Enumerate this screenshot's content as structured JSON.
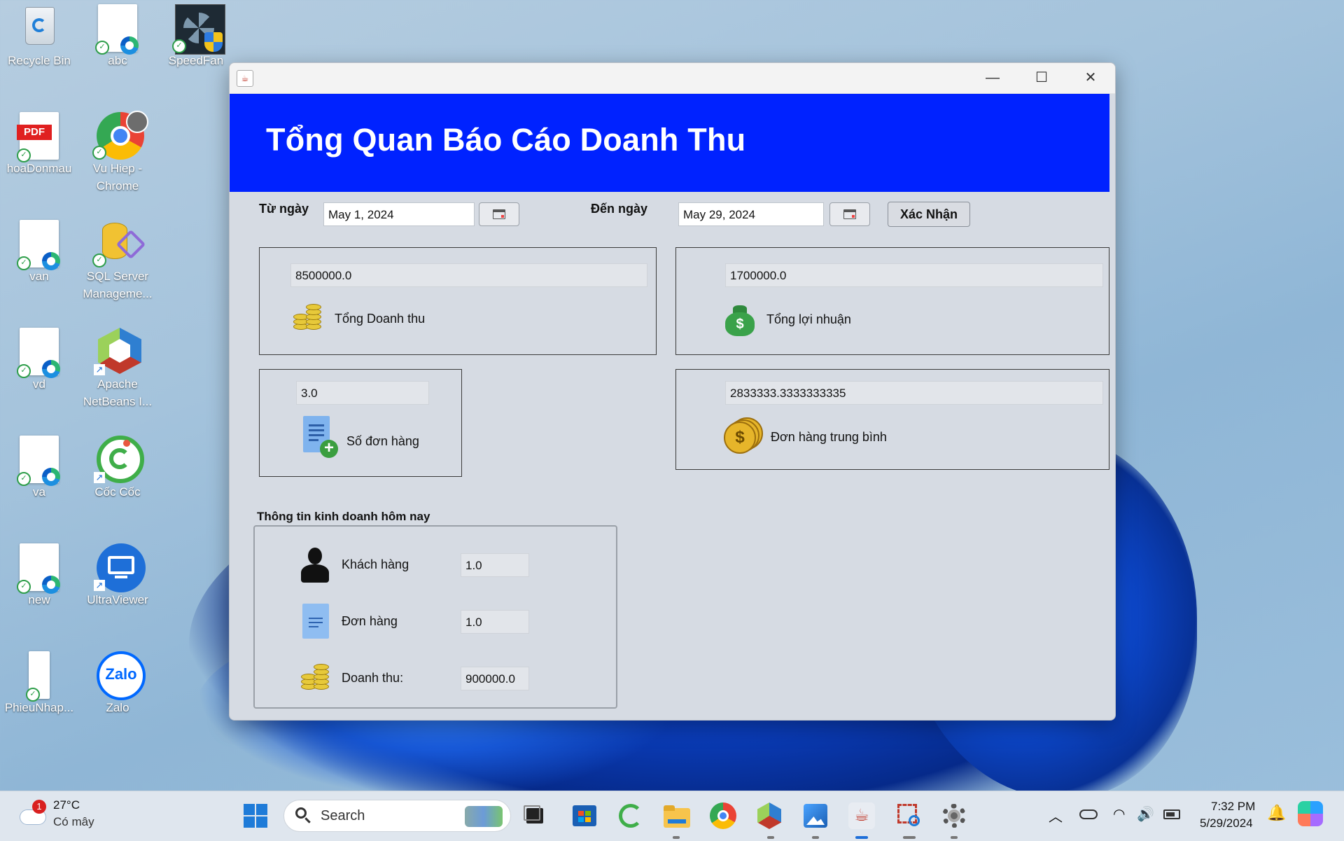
{
  "desktop": {
    "icons": [
      {
        "label": "Recycle Bin"
      },
      {
        "label": "abc"
      },
      {
        "label": "SpeedFan"
      },
      {
        "label": "hoaDonmau"
      },
      {
        "label": "Vu Hiep - Chrome"
      },
      {
        "label": "van"
      },
      {
        "label": "SQL Server Manageme..."
      },
      {
        "label": "vd"
      },
      {
        "label": "Apache NetBeans I..."
      },
      {
        "label": "va"
      },
      {
        "label": "Cốc Cốc"
      },
      {
        "label": "new"
      },
      {
        "label": "UltraViewer"
      },
      {
        "label": "PhieuNhap..."
      },
      {
        "label": "Zalo"
      }
    ],
    "pdf_badge": "PDF",
    "zalo_logo": "Zalo"
  },
  "window": {
    "title": "Tổng Quan Báo Cáo Doanh Thu",
    "from_label": "Từ ngày",
    "from_value": "May 1, 2024",
    "to_label": "Đến ngày",
    "to_value": "May 29, 2024",
    "confirm_label": "Xác Nhận",
    "cards": {
      "revenue": {
        "value": "8500000.0",
        "label": "Tổng Doanh thu"
      },
      "profit": {
        "value": "1700000.0",
        "label": "Tổng lợi nhuận"
      },
      "orders": {
        "value": "3.0",
        "label": "Số đơn hàng"
      },
      "avg_order": {
        "value": "2833333.3333333335",
        "label": "Đơn hàng trung bình"
      }
    },
    "today": {
      "title": "Thông tin kinh doanh hôm nay",
      "customers_label": "Khách hàng",
      "customers_value": "1.0",
      "orders_label": "Đơn hàng",
      "orders_value": "1.0",
      "revenue_label": "Doanh thu:",
      "revenue_value": "900000.0"
    }
  },
  "taskbar": {
    "weather_temp": "27°C",
    "weather_desc": "Có mây",
    "weather_badge": "1",
    "search_placeholder": "Search",
    "time": "7:32 PM",
    "date": "5/29/2024"
  },
  "colors": {
    "header_bg": "#0022ff",
    "window_bg": "#d6dbe3"
  }
}
